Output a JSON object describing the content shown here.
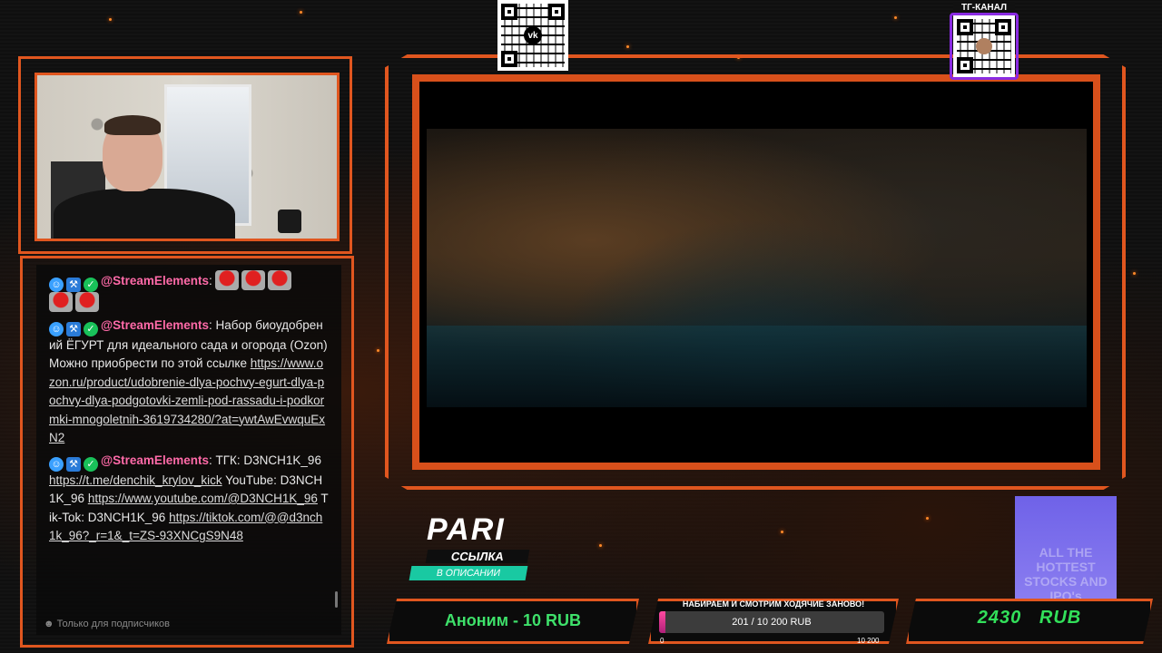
{
  "qr": {
    "vk_icon": "vk-icon",
    "tg_label": "ТГ-КАНАЛ"
  },
  "chat": {
    "messages": [
      {
        "user": "@StreamElements",
        "text": "",
        "emotes": 5
      },
      {
        "user": "@StreamElements",
        "text": "Набор биоудобрений ЁГУРТ для идеального сада и огорода (Ozon) Можно приобрести по этой ссылке",
        "link": "https://www.ozon.ru/product/udobrenie-dlya-pochvy-egurt-dlya-pochvy-dlya-podgotovki-zemli-pod-rassadu-i-podkormki-mnogoletnih-3619734280/?at=ywtAwEvwquExN2"
      },
      {
        "user": "@StreamElements",
        "text_1": "ТГК: D3NCH1K_96",
        "link_1": "https://t.me/denchik_krylov_kick",
        "text_2": "YouTube: D3NCH1K_96",
        "link_2": "https://www.youtube.com/@D3NCH1K_96",
        "text_3": "Tik-Tok: D3NCH1K_96",
        "link_3": "https://tiktok.com/@@d3nch1k_96?_r=1&_t=ZS-93XNCgS9N48"
      }
    ],
    "footer": "Только для подписчиков"
  },
  "promo": {
    "logo": "PARI",
    "link_label": "ССЫЛКА",
    "desc": "В ОПИСАНИИ"
  },
  "ad": {
    "text": "ALL THE HOTTEST STOCKS AND IPO's"
  },
  "donation": {
    "last": "Аноним - 10 RUB"
  },
  "goal": {
    "title": "НАБИРАЕМ И СМОТРИМ ХОДЯЧИЕ ЗАНОВО!",
    "value_text": "201 / 10 200 RUB",
    "current": 201,
    "target": 10200,
    "min_label": "0",
    "max_label": "10 200"
  },
  "total": {
    "text": "2430   RUB"
  },
  "colors": {
    "accent": "#e0561f",
    "chat_user": "#ff6aa8",
    "money_green": "#32e05a",
    "pari_teal": "#19c9a2",
    "goal_pink": "#ff4aa0"
  }
}
